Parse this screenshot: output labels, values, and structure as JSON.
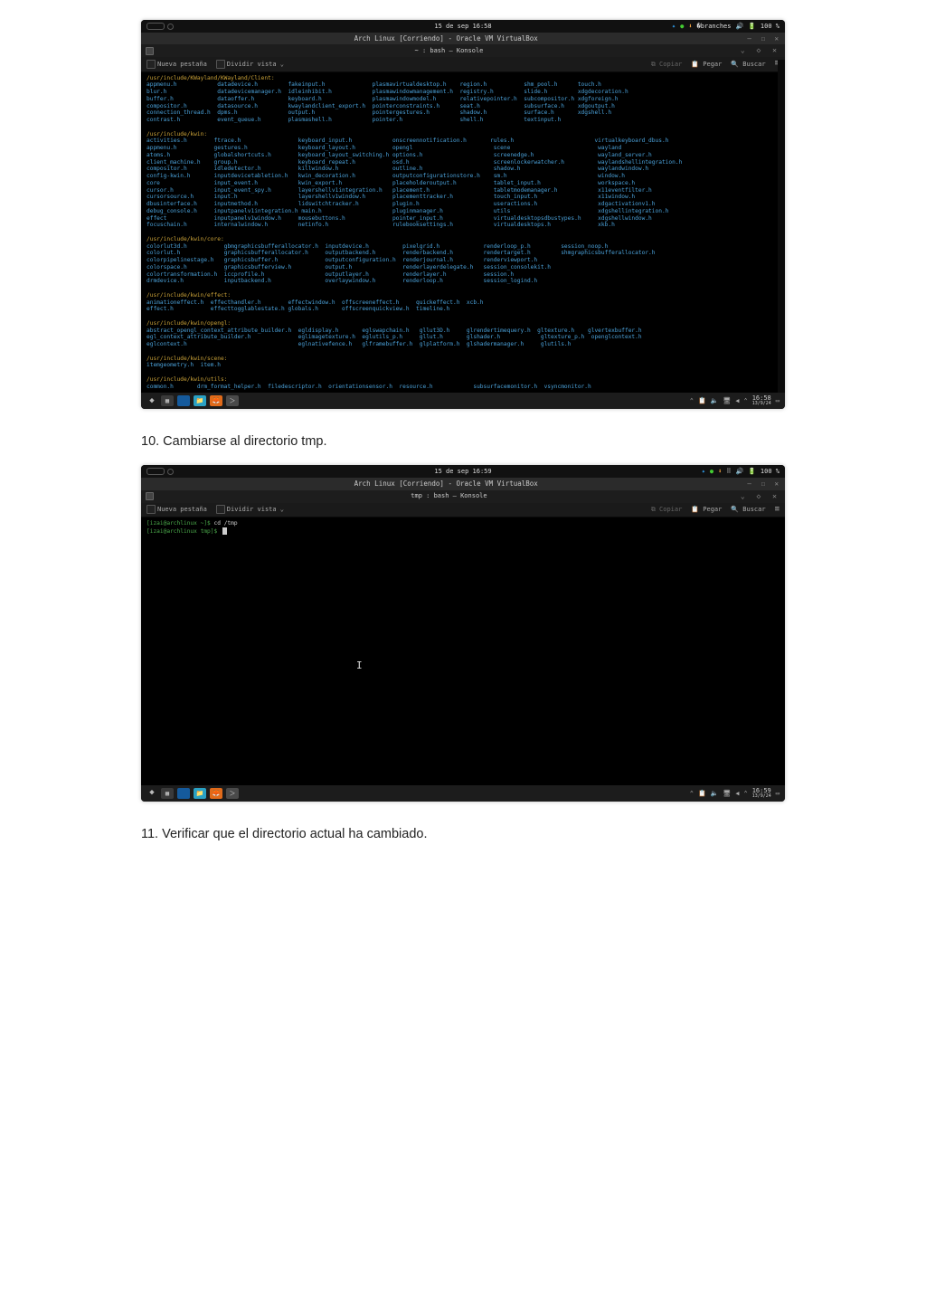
{
  "page": {
    "step10": "10. Cambiarse al directorio tmp.",
    "step11": "11. Verificar que el directorio actual ha cambiado."
  },
  "panel": {
    "time1": "15 de sep  16:58",
    "time2": "15 de sep  16:59",
    "battery": "100 %"
  },
  "vm": {
    "title": "Arch Linux [Corriendo] - Oracle VM VirtualBox"
  },
  "konsole": {
    "title1": "~ : bash — Konsole",
    "title2": "tmp : bash — Konsole",
    "new_tab": "Nueva pestaña",
    "split": "Dividir vista",
    "copy": "Copiar",
    "paste": "Pegar",
    "search": "Buscar"
  },
  "clock": {
    "t1a": "16:58",
    "t1b": "13/9/24",
    "t2a": "16:59",
    "t2b": "13/9/24"
  },
  "termA": {
    "dir1": "/usr/include/KWayland/KWayland/Client:",
    "d1": "appmenu.h            datadevice.h         fakeinput.h              plasmavirtualdesktop.h    region.h           shm_pool.h      touch.h\nblur.h               datadevicemanager.h  idleinhibit.h            plasmawindowmanagement.h  registry.h         slide.h         xdgdecoration.h\nbuffer.h             dataoffer.h          keyboard.h               plasmawindowmodel.h       relativepointer.h  subcompositor.h xdgforeign.h\ncompositor.h         datasource.h         kwaylandclient_export.h  pointerconstraints.h      seat.h             subsurface.h    xdgoutput.h\nconnection_thread.h  dpms.h               output.h                 pointergestures.h         shadow.h           surface.h       xdgshell.h\ncontrast.h           event_queue.h        plasmashell.h            pointer.h                 shell.h            textinput.h",
    "dir2": "/usr/include/kwin:",
    "d2": "activities.h        ftrace.h                 keyboard_input.h            onscreennotification.h       rules.h                        virtualkeyboard_dbus.h\nappmenu.h           gestures.h               keyboard_layout.h           opengl                        scene                          wayland\natoms.h             globalshortcuts.h        keyboard_layout_switching.h options.h                     screenedge.h                   wayland_server.h\nclient_machine.h    group.h                  keyboard_repeat.h           osd.h                         screenlockerwatcher.h          waylandshellintegration.h\ncompositor.h        idledetector.h           killwindow.h                outline.h                     shadow.h                       waylandwindow.h\nconfig-kwin.h       inputdevicetabletion.h   kwin_decoration.h           outputconfigurationstore.h    sm.h                           window.h\ncore                input_event.h            kwin_export.h               placeholderoutput.h           tablet_input.h                 workspace.h\ncursor.h            input_event_spy.h        layershellv1integration.h   placement.h                   tabletmodemanager.h            x11eventfilter.h\ncursorsource.h      input.h                  layershellv1window.h        placementtracker.h            touch_input.h                  x11window.h\ndbusinterface.h     inputmethod.h            lidswitchtracker.h          plugin.h                      useractions.h                  xdgactivationv1.h\ndebug_console.h     inputpanelv1integration.h main.h                     pluginmanager.h               utils                          xdgshellintegration.h\neffect              inputpanelv1window.h     mousebuttons.h              pointer_input.h               virtualdesktopsdbustypes.h     xdgshellwindow.h\nfocuschain.h        internalwindow.h         netinfo.h                   rulebooksettings.h            virtualdesktops.h              xkb.h",
    "dir3": "/usr/include/kwin/core:",
    "d3": "colorlut3d.h           gbmgraphicsbufferallocator.h  inputdevice.h          pixelgrid.h             renderloop_p.h         session_noop.h\ncolorlut.h             graphicsbufferallocator.h     outputbackend.h        renderbackend.h         rendertarget.h         shmgraphicsbufferallocator.h\ncolorpipelinestage.h   graphicsbuffer.h              outputconfiguration.h  renderjournal.h         renderviewport.h\ncolorspace.h           graphicsbufferview.h          output.h               renderlayerdelegate.h   session_consolekit.h\ncolortransformation.h  iccprofile.h                  outputlayer.h          renderlayer.h           session.h\ndrmdevice.h            inputbackend.h                overlaywindow.h        renderloop.h            session_logind.h",
    "dir4": "/usr/include/kwin/effect:",
    "d4": "animationeffect.h  effecthandler.h        effectwindow.h  offscreeneffect.h     quickeffect.h  xcb.h\neffect.h           effecttogglablestate.h globals.h       offscreenquickview.h  timeline.h",
    "dir5": "/usr/include/kwin/opengl:",
    "d5": "abstract_opengl_context_attribute_builder.h  egldisplay.h       eglswapchain.h   gllut3D.h     glrendertimequery.h  gltexture.h    glvertexbuffer.h\negl_context_attribute_builder.h              eglimagetexture.h  eglutils_p.h     gllut.h       glshader.h            gltexture_p.h  openglcontext.h\neglcontext.h                                 eglnativefence.h   glframebuffer.h  glplatform.h  glshadermanager.h     glutils.h",
    "dir6": "/usr/include/kwin/scene:",
    "d6": "itemgeometry.h  item.h",
    "dir7": "/usr/include/kwin/utils:",
    "d7": "common.h       drm_format_helper.h  filedescriptor.h  orientationsensor.h  resource.h            subsurfacemonitor.h  vsyncmonitor.h"
  },
  "termB": {
    "l1_prompt_user": "[izai@archlinux ~]$ ",
    "l1_cmd": "cd /tmp",
    "l2_prompt_user": "[izai@archlinux tmp]$ "
  }
}
